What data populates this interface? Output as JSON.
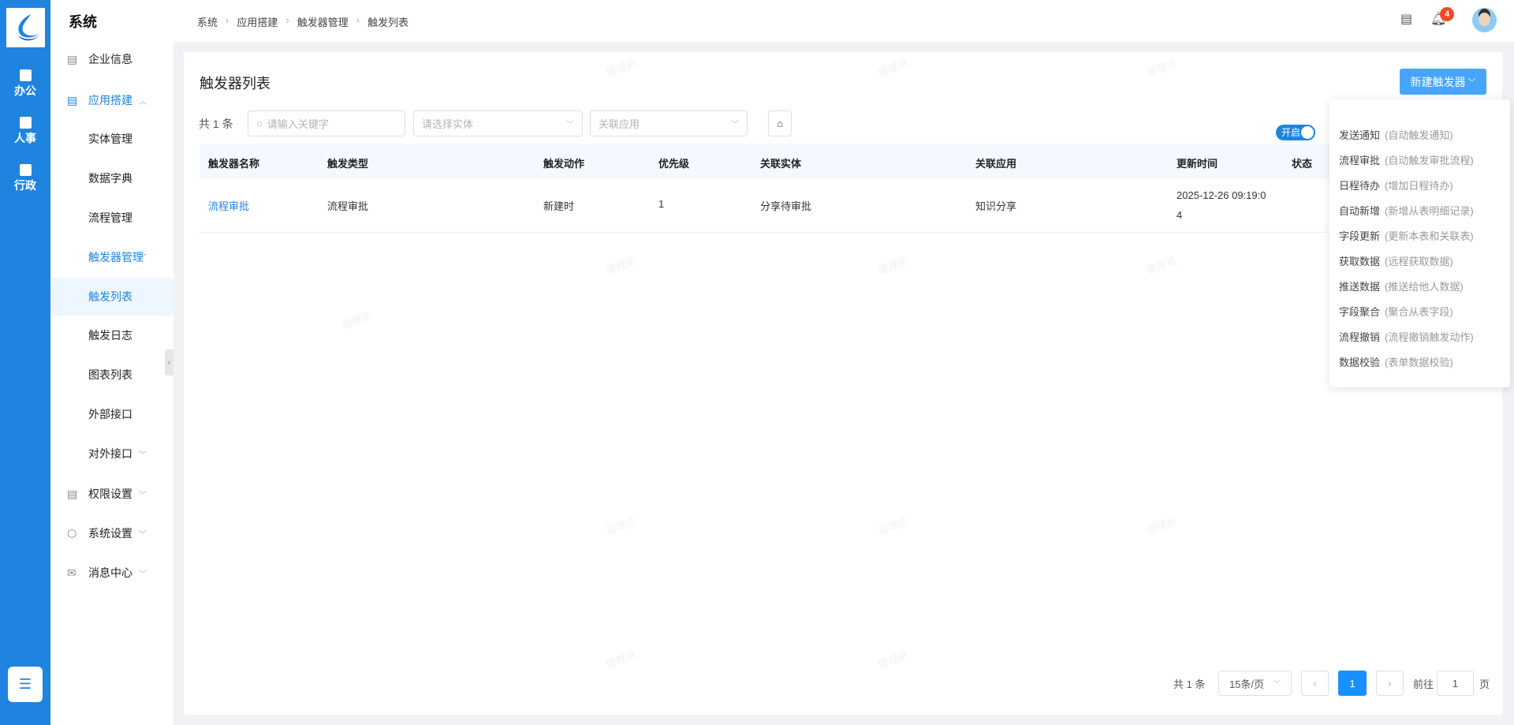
{
  "rail": {
    "items": [
      {
        "label": "办公"
      },
      {
        "label": "人事"
      },
      {
        "label": "行政"
      }
    ]
  },
  "menu": {
    "title": "系统",
    "items": [
      {
        "label": "企业信息"
      },
      {
        "label": "应用搭建"
      },
      {
        "label": "实体管理"
      },
      {
        "label": "数据字典"
      },
      {
        "label": "流程管理"
      },
      {
        "label": "触发器管理"
      },
      {
        "label": "触发列表"
      },
      {
        "label": "触发日志"
      },
      {
        "label": "图表列表"
      },
      {
        "label": "外部接口"
      },
      {
        "label": "对外接口"
      },
      {
        "label": "权限设置"
      },
      {
        "label": "系统设置"
      },
      {
        "label": "消息中心"
      }
    ]
  },
  "breadcrumb": [
    "系统",
    "应用搭建",
    "触发器管理",
    "触发列表"
  ],
  "header": {
    "notification_count": "4"
  },
  "watermark": "管理员",
  "page": {
    "title": "触发器列表",
    "new_button": "新建触发器",
    "count": "共 1 条",
    "search_placeholder": "请输入关键字",
    "entity_placeholder": "请选择实体",
    "app_placeholder": "关联应用"
  },
  "table": {
    "columns": [
      "触发器名称",
      "触发类型",
      "触发动作",
      "优先级",
      "关联实体",
      "关联应用",
      "更新时间",
      "状态"
    ],
    "rows": [
      {
        "name": "流程审批",
        "type": "流程审批",
        "action": "新建时",
        "priority": "1",
        "entity": "分享待审批",
        "app": "知识分享",
        "updated": "2025-12-26 09:19:0",
        "updated2": "4",
        "status": "开启"
      }
    ]
  },
  "dropdown": [
    {
      "label": "发送通知",
      "desc": "(自动触发通知)"
    },
    {
      "label": "流程审批",
      "desc": "(自动触发审批流程)"
    },
    {
      "label": "日程待办",
      "desc": "(增加日程待办)"
    },
    {
      "label": "自动新增",
      "desc": "(新增从表明细记录)"
    },
    {
      "label": "字段更新",
      "desc": "(更新本表和关联表)"
    },
    {
      "label": "获取数据",
      "desc": "(远程获取数据)"
    },
    {
      "label": "推送数据",
      "desc": "(推送给他人数据)"
    },
    {
      "label": "字段聚合",
      "desc": "(聚合从表字段)"
    },
    {
      "label": "流程撤销",
      "desc": "(流程撤销触发动作)"
    },
    {
      "label": "数据校验",
      "desc": "(表单数据校验)"
    }
  ],
  "pagination": {
    "total": "共 1 条",
    "page_size": "15条/页",
    "current": "1",
    "goto_label": "前往",
    "goto_value": "1",
    "page_suffix": "页"
  }
}
